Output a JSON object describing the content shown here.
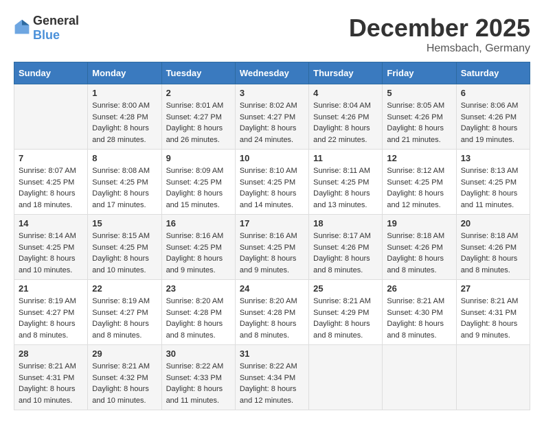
{
  "logo": {
    "general": "General",
    "blue": "Blue"
  },
  "header": {
    "month": "December 2025",
    "location": "Hemsbach, Germany"
  },
  "weekdays": [
    "Sunday",
    "Monday",
    "Tuesday",
    "Wednesday",
    "Thursday",
    "Friday",
    "Saturday"
  ],
  "weeks": [
    [
      {
        "day": "",
        "sunrise": "",
        "sunset": "",
        "daylight": ""
      },
      {
        "day": "1",
        "sunrise": "Sunrise: 8:00 AM",
        "sunset": "Sunset: 4:28 PM",
        "daylight": "Daylight: 8 hours and 28 minutes."
      },
      {
        "day": "2",
        "sunrise": "Sunrise: 8:01 AM",
        "sunset": "Sunset: 4:27 PM",
        "daylight": "Daylight: 8 hours and 26 minutes."
      },
      {
        "day": "3",
        "sunrise": "Sunrise: 8:02 AM",
        "sunset": "Sunset: 4:27 PM",
        "daylight": "Daylight: 8 hours and 24 minutes."
      },
      {
        "day": "4",
        "sunrise": "Sunrise: 8:04 AM",
        "sunset": "Sunset: 4:26 PM",
        "daylight": "Daylight: 8 hours and 22 minutes."
      },
      {
        "day": "5",
        "sunrise": "Sunrise: 8:05 AM",
        "sunset": "Sunset: 4:26 PM",
        "daylight": "Daylight: 8 hours and 21 minutes."
      },
      {
        "day": "6",
        "sunrise": "Sunrise: 8:06 AM",
        "sunset": "Sunset: 4:26 PM",
        "daylight": "Daylight: 8 hours and 19 minutes."
      }
    ],
    [
      {
        "day": "7",
        "sunrise": "Sunrise: 8:07 AM",
        "sunset": "Sunset: 4:25 PM",
        "daylight": "Daylight: 8 hours and 18 minutes."
      },
      {
        "day": "8",
        "sunrise": "Sunrise: 8:08 AM",
        "sunset": "Sunset: 4:25 PM",
        "daylight": "Daylight: 8 hours and 17 minutes."
      },
      {
        "day": "9",
        "sunrise": "Sunrise: 8:09 AM",
        "sunset": "Sunset: 4:25 PM",
        "daylight": "Daylight: 8 hours and 15 minutes."
      },
      {
        "day": "10",
        "sunrise": "Sunrise: 8:10 AM",
        "sunset": "Sunset: 4:25 PM",
        "daylight": "Daylight: 8 hours and 14 minutes."
      },
      {
        "day": "11",
        "sunrise": "Sunrise: 8:11 AM",
        "sunset": "Sunset: 4:25 PM",
        "daylight": "Daylight: 8 hours and 13 minutes."
      },
      {
        "day": "12",
        "sunrise": "Sunrise: 8:12 AM",
        "sunset": "Sunset: 4:25 PM",
        "daylight": "Daylight: 8 hours and 12 minutes."
      },
      {
        "day": "13",
        "sunrise": "Sunrise: 8:13 AM",
        "sunset": "Sunset: 4:25 PM",
        "daylight": "Daylight: 8 hours and 11 minutes."
      }
    ],
    [
      {
        "day": "14",
        "sunrise": "Sunrise: 8:14 AM",
        "sunset": "Sunset: 4:25 PM",
        "daylight": "Daylight: 8 hours and 10 minutes."
      },
      {
        "day": "15",
        "sunrise": "Sunrise: 8:15 AM",
        "sunset": "Sunset: 4:25 PM",
        "daylight": "Daylight: 8 hours and 10 minutes."
      },
      {
        "day": "16",
        "sunrise": "Sunrise: 8:16 AM",
        "sunset": "Sunset: 4:25 PM",
        "daylight": "Daylight: 8 hours and 9 minutes."
      },
      {
        "day": "17",
        "sunrise": "Sunrise: 8:16 AM",
        "sunset": "Sunset: 4:25 PM",
        "daylight": "Daylight: 8 hours and 9 minutes."
      },
      {
        "day": "18",
        "sunrise": "Sunrise: 8:17 AM",
        "sunset": "Sunset: 4:26 PM",
        "daylight": "Daylight: 8 hours and 8 minutes."
      },
      {
        "day": "19",
        "sunrise": "Sunrise: 8:18 AM",
        "sunset": "Sunset: 4:26 PM",
        "daylight": "Daylight: 8 hours and 8 minutes."
      },
      {
        "day": "20",
        "sunrise": "Sunrise: 8:18 AM",
        "sunset": "Sunset: 4:26 PM",
        "daylight": "Daylight: 8 hours and 8 minutes."
      }
    ],
    [
      {
        "day": "21",
        "sunrise": "Sunrise: 8:19 AM",
        "sunset": "Sunset: 4:27 PM",
        "daylight": "Daylight: 8 hours and 8 minutes."
      },
      {
        "day": "22",
        "sunrise": "Sunrise: 8:19 AM",
        "sunset": "Sunset: 4:27 PM",
        "daylight": "Daylight: 8 hours and 8 minutes."
      },
      {
        "day": "23",
        "sunrise": "Sunrise: 8:20 AM",
        "sunset": "Sunset: 4:28 PM",
        "daylight": "Daylight: 8 hours and 8 minutes."
      },
      {
        "day": "24",
        "sunrise": "Sunrise: 8:20 AM",
        "sunset": "Sunset: 4:28 PM",
        "daylight": "Daylight: 8 hours and 8 minutes."
      },
      {
        "day": "25",
        "sunrise": "Sunrise: 8:21 AM",
        "sunset": "Sunset: 4:29 PM",
        "daylight": "Daylight: 8 hours and 8 minutes."
      },
      {
        "day": "26",
        "sunrise": "Sunrise: 8:21 AM",
        "sunset": "Sunset: 4:30 PM",
        "daylight": "Daylight: 8 hours and 8 minutes."
      },
      {
        "day": "27",
        "sunrise": "Sunrise: 8:21 AM",
        "sunset": "Sunset: 4:31 PM",
        "daylight": "Daylight: 8 hours and 9 minutes."
      }
    ],
    [
      {
        "day": "28",
        "sunrise": "Sunrise: 8:21 AM",
        "sunset": "Sunset: 4:31 PM",
        "daylight": "Daylight: 8 hours and 10 minutes."
      },
      {
        "day": "29",
        "sunrise": "Sunrise: 8:21 AM",
        "sunset": "Sunset: 4:32 PM",
        "daylight": "Daylight: 8 hours and 10 minutes."
      },
      {
        "day": "30",
        "sunrise": "Sunrise: 8:22 AM",
        "sunset": "Sunset: 4:33 PM",
        "daylight": "Daylight: 8 hours and 11 minutes."
      },
      {
        "day": "31",
        "sunrise": "Sunrise: 8:22 AM",
        "sunset": "Sunset: 4:34 PM",
        "daylight": "Daylight: 8 hours and 12 minutes."
      },
      {
        "day": "",
        "sunrise": "",
        "sunset": "",
        "daylight": ""
      },
      {
        "day": "",
        "sunrise": "",
        "sunset": "",
        "daylight": ""
      },
      {
        "day": "",
        "sunrise": "",
        "sunset": "",
        "daylight": ""
      }
    ]
  ]
}
